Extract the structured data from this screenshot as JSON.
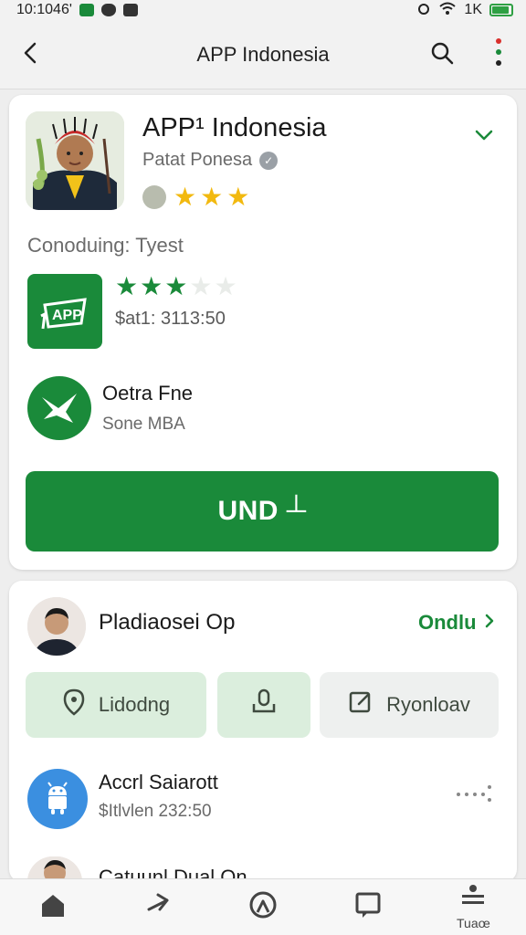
{
  "status_bar": {
    "time": "10:1046'",
    "battery": "1K"
  },
  "app_bar": {
    "title": "APP Indonesia"
  },
  "app": {
    "name": "APP¹ Indonesia",
    "developer": "Patat Ponesa",
    "rating_stars": 3
  },
  "section": {
    "label": "Conoduing: Tyest"
  },
  "related_apps": [
    {
      "rating_stars": 3,
      "rating_max": 5,
      "price": "$at1: 3113:50",
      "icon": "app-logo-icon"
    },
    {
      "title": "Oetra Fne",
      "subtitle": "Sone MBA",
      "icon": "bird-icon"
    }
  ],
  "install_button": {
    "label": "UND ┴"
  },
  "publisher": {
    "name": "Pladiaosei Op",
    "open_label": "Ondlu"
  },
  "chips": [
    {
      "label": "Lidodng",
      "icon": "location-pin-icon"
    },
    {
      "label": "",
      "icon": "microphone-icon"
    },
    {
      "label": "Ryonloav",
      "icon": "edit-icon"
    }
  ],
  "list_item": {
    "title": "Accrl Saiarott",
    "subtitle": "$Itlvlen 232:50",
    "icon": "android-icon"
  },
  "peek_item": {
    "title": "Catuunl Dual On"
  },
  "bottom_nav": [
    {
      "icon": "home-icon",
      "label": ""
    },
    {
      "icon": "share-icon",
      "label": ""
    },
    {
      "icon": "map-pin-icon",
      "label": ""
    },
    {
      "icon": "chat-icon",
      "label": ""
    },
    {
      "icon": "menu-icon",
      "label": "Tuaœ"
    }
  ],
  "colors": {
    "primary_green": "#1a8a3a",
    "star_gold": "#f2b90f",
    "chip_green": "#dbeedd",
    "accent_blue": "#3b8fe0"
  }
}
